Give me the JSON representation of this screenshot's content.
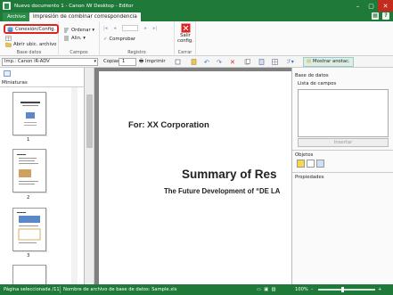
{
  "window": {
    "title": "Nuevo documento 1 - Canon iW Desktop - Editor",
    "controls": [
      "minimize",
      "maximize",
      "close"
    ]
  },
  "ribbon_tabs": {
    "file": "Archivo",
    "active": "Impresión de combinar correspondencia"
  },
  "ribbon": {
    "base_datos": {
      "label": "Base datos",
      "conexion": "Conexión/Config.",
      "item2": "",
      "abrir": "Abrir ubic. archivo"
    },
    "campos": {
      "label": "Campos",
      "ordenar": "Ordenar",
      "alin": "Alin."
    },
    "registro": {
      "label": "Registro",
      "comprobar": "Comprobar"
    },
    "cerrar": {
      "label": "Cerrar",
      "salir": "Salir config."
    }
  },
  "printbar": {
    "printer": "Imp.: Canon iR-ADV",
    "copies_label": "Copias:",
    "copies_value": "1",
    "print_label": "Imprimir",
    "show_notes": "Mostrar anotac."
  },
  "left_pane": {
    "title": "Miniaturas",
    "pages": [
      "1",
      "2",
      "3"
    ]
  },
  "document": {
    "for_text": "For: XX Corporation",
    "summary": "Summary of Res",
    "future": "The Future Development of “DE LA"
  },
  "right_pane": {
    "database_heading": "Base de datos",
    "field_list_label": "Lista de campos",
    "insert_button": "Insertar",
    "objects_heading": "Objetos",
    "properties_heading": "Propiedades"
  },
  "status": {
    "page": "Página seleccionada /11",
    "db_file": "Nombre de archivo de base de datos: Sample.xls",
    "zoom": "100%"
  },
  "colors": {
    "accent": "#1f7a3a",
    "highlight": "#e1231f"
  }
}
